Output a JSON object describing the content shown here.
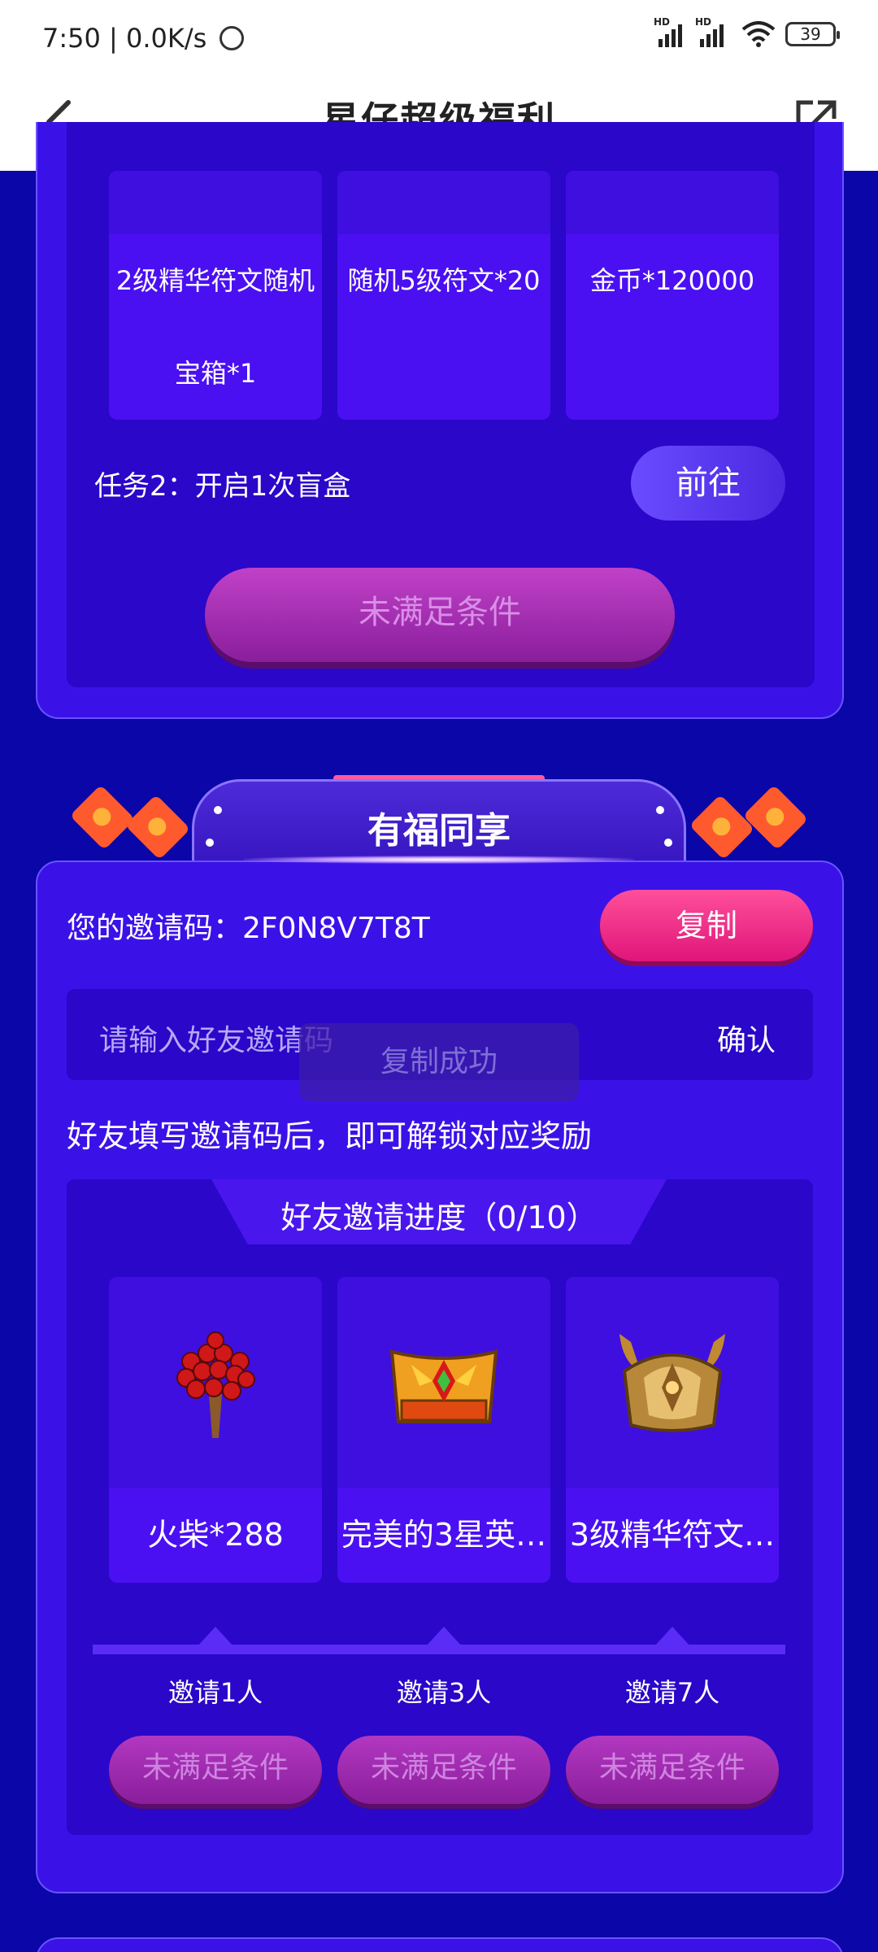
{
  "status": {
    "time": "7:50",
    "speed": "0.0K/s",
    "battery": "39",
    "hd1": "HD",
    "hd2": "HD"
  },
  "header": {
    "title": "星仔超级福利"
  },
  "task_section": {
    "rewards": [
      {
        "label": "2级精华符文随机宝箱*1",
        "line1": "2级精华符文随机",
        "line2": "宝箱*1"
      },
      {
        "label": "随机5级符文*20"
      },
      {
        "label": "金币*120000"
      }
    ],
    "task_text": "任务2：开启1次盲盒",
    "go_label": "前往",
    "claim_label": "未满足条件"
  },
  "share_section": {
    "title": "有福同享",
    "invite_code_text": "您的邀请码：2F0N8V7T8T",
    "copy_label": "复制",
    "input_placeholder": "请输入好友邀请码",
    "confirm_label": "确认",
    "toast": "复制成功",
    "hint": "好友填写邀请码后，即可解锁对应奖励",
    "progress_title": "好友邀请进度（0/10）",
    "rewards": [
      {
        "label": "火柴*288",
        "icon": "matches-bouquet-icon",
        "milestone": "邀请1人",
        "button": "未满足条件"
      },
      {
        "label": "完美的3星英…",
        "icon": "treasure-chest-icon",
        "milestone": "邀请3人",
        "button": "未满足条件"
      },
      {
        "label": "3级精华符文…",
        "icon": "golden-crown-icon",
        "milestone": "邀请7人",
        "button": "未满足条件"
      }
    ]
  }
}
